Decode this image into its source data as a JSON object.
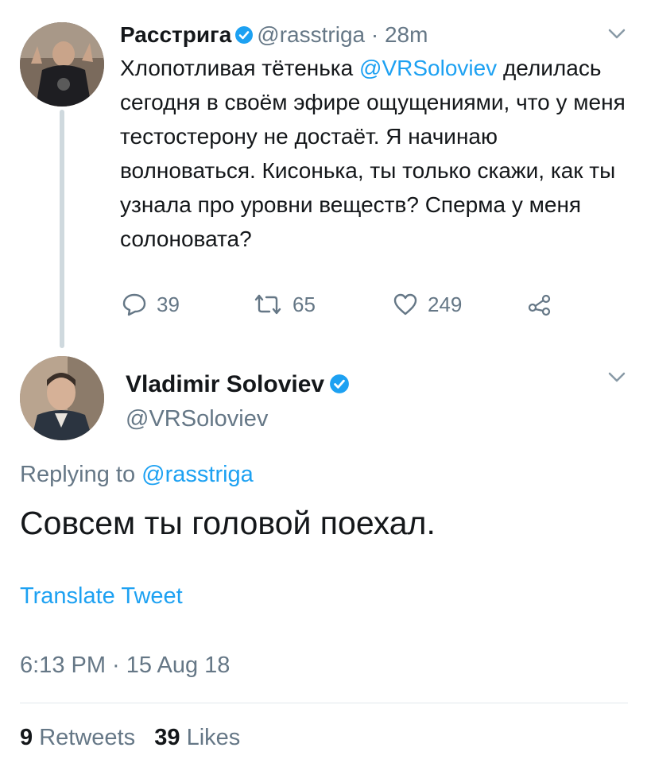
{
  "tweet1": {
    "author_name": "Расстрига",
    "handle": "@rasstriga",
    "separator": "·",
    "time": "28m",
    "text_before": "Хлопотливая тётенька ",
    "mention": "@VRSoloviev",
    "text_after": " делилась сегодня в своём эфире ощущениями, что у меня тестостерону не достаёт. Я начинаю волноваться. Кисонька, ты только скажи, как ты узнала про уровни веществ? Сперма у меня солоновата?",
    "reply_count": "39",
    "retweet_count": "65",
    "like_count": "249"
  },
  "tweet2": {
    "author_name": "Vladimir Soloviev",
    "handle": "@VRSoloviev",
    "replying_label": "Replying to ",
    "replying_handle": "@rasstriga",
    "text": "Совсем ты головой поехал.",
    "translate_label": "Translate Tweet",
    "timestamp": "6:13 PM · 15 Aug 18",
    "retweets_count": "9",
    "retweets_label": "Retweets",
    "likes_count": "39",
    "likes_label": "Likes"
  },
  "colors": {
    "accent": "#1da1f2",
    "secondary_text": "#657786",
    "primary_text": "#14171a",
    "thread_line": "#cfd9de"
  },
  "icons": [
    "verified-badge-icon",
    "chevron-down-icon",
    "reply-icon",
    "retweet-icon",
    "like-icon",
    "share-icon"
  ]
}
